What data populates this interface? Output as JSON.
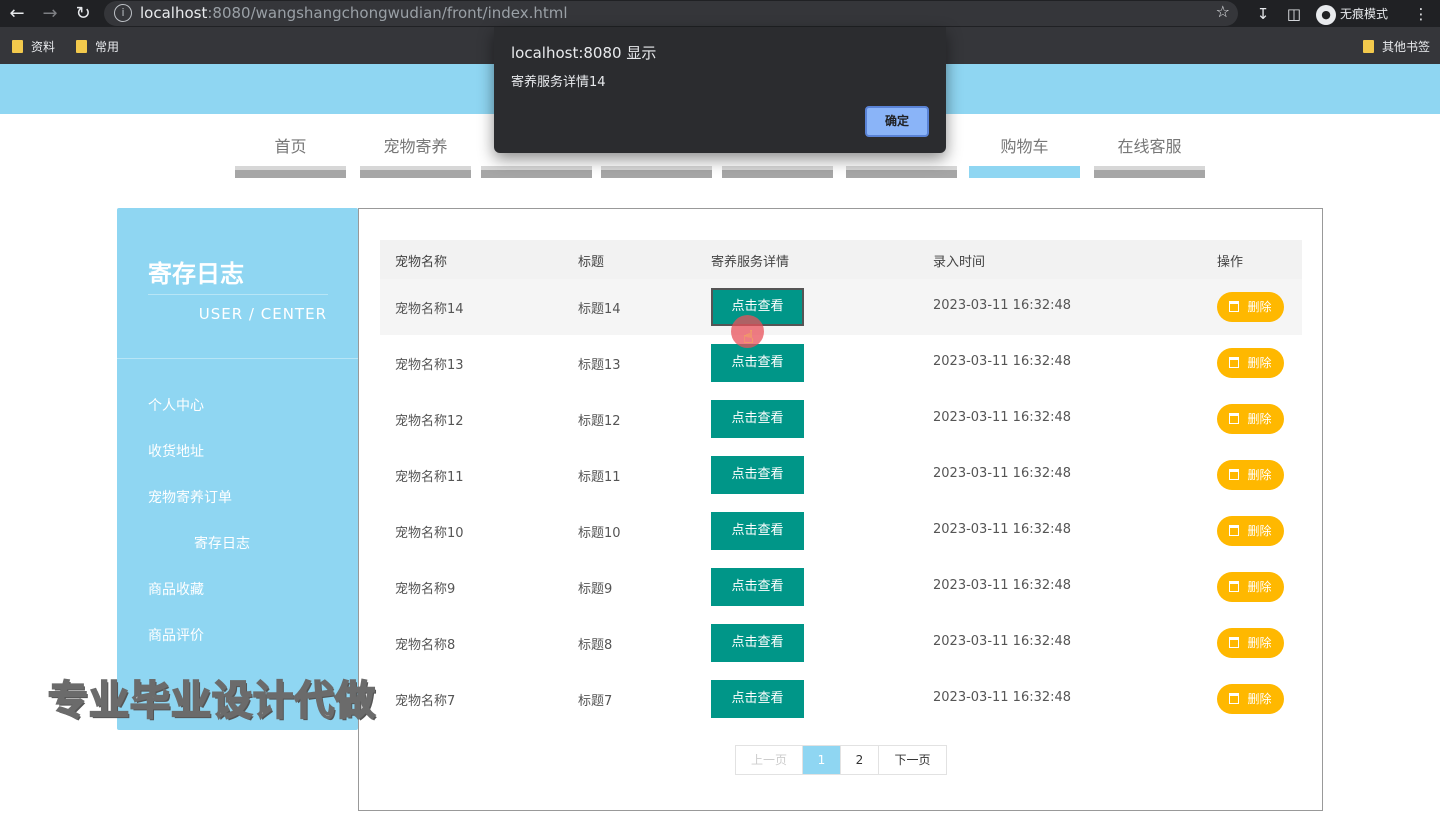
{
  "browser": {
    "url_host": "localhost",
    "url_rest": ":8080/wangshangchongwudian/front/index.html",
    "incognito_label": "无痕模式",
    "bookmarks": [
      "资料",
      "常用"
    ],
    "other_bookmarks": "其他书签"
  },
  "dialog": {
    "title": "localhost:8080 显示",
    "message": "寄养服务详情14",
    "ok_label": "确定"
  },
  "nav": {
    "tabs": [
      "首页",
      "宠物寄养",
      "",
      "",
      "",
      "",
      "购物车",
      "在线客服"
    ],
    "active_index": 6
  },
  "sidebar": {
    "title": "寄存日志",
    "subtitle": "USER / CENTER",
    "items": [
      "个人中心",
      "收货地址",
      "宠物寄养订单",
      "寄存日志",
      "商品收藏",
      "商品评价"
    ]
  },
  "watermark": "专业毕业设计代做",
  "table": {
    "headers": [
      "宠物名称",
      "标题",
      "寄养服务详情",
      "录入时间",
      "操作"
    ],
    "view_label": "点击查看",
    "delete_label": "删除",
    "rows": [
      {
        "name": "宠物名称14",
        "title": "标题14",
        "time": "2023-03-11 16:32:48"
      },
      {
        "name": "宠物名称13",
        "title": "标题13",
        "time": "2023-03-11 16:32:48"
      },
      {
        "name": "宠物名称12",
        "title": "标题12",
        "time": "2023-03-11 16:32:48"
      },
      {
        "name": "宠物名称11",
        "title": "标题11",
        "time": "2023-03-11 16:32:48"
      },
      {
        "name": "宠物名称10",
        "title": "标题10",
        "time": "2023-03-11 16:32:48"
      },
      {
        "name": "宠物名称9",
        "title": "标题9",
        "time": "2023-03-11 16:32:48"
      },
      {
        "name": "宠物名称8",
        "title": "标题8",
        "time": "2023-03-11 16:32:48"
      },
      {
        "name": "宠物名称7",
        "title": "标题7",
        "time": "2023-03-11 16:32:48"
      }
    ]
  },
  "pager": {
    "prev": "上一页",
    "pages": [
      "1",
      "2"
    ],
    "current": "1",
    "next": "下一页"
  }
}
